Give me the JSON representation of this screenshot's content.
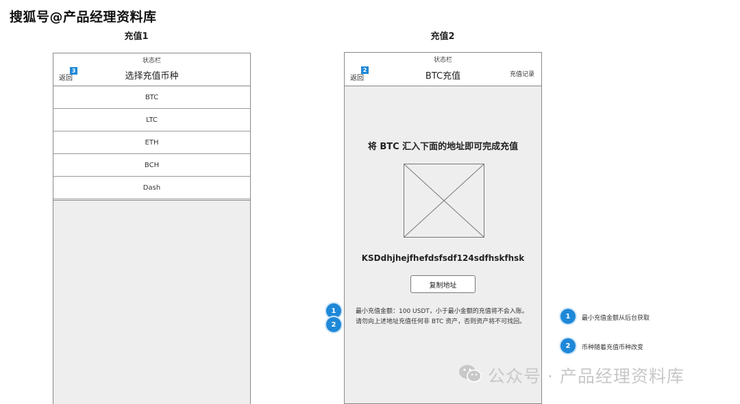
{
  "watermark_top": "搜狐号@产品经理资料库",
  "screen1": {
    "title": "充值1",
    "status_bar": "状态栏",
    "back_label": "返回",
    "badge": "3",
    "nav_title": "选择充值币种",
    "coins": [
      "BTC",
      "LTC",
      "ETH",
      "BCH",
      "Dash"
    ]
  },
  "screen2": {
    "title": "充值2",
    "status_bar": "状态栏",
    "back_label": "返回",
    "badge": "2",
    "nav_title": "BTC充值",
    "nav_right": "充值记录",
    "headline": "将 BTC 汇入下面的地址即可完成充值",
    "address": "KSDdhjhejfhefdsfsdf124sdfhskfhsk",
    "copy_button": "复制地址",
    "notice_line1": "最小充值金额：100 USDT，小于最小金额的充值将不会入账。",
    "notice_line2": "请勿向上述地址充值任何非 BTC 资产，否则资产将不可找回。",
    "left_badges": [
      "1",
      "2"
    ]
  },
  "annotations": [
    {
      "number": "1",
      "text": "最小充值金额从后台获取"
    },
    {
      "number": "2",
      "text": "币种随着充值币种改变"
    }
  ],
  "watermark_bottom": "公众号 · 产品经理资料库",
  "colors": {
    "accent": "#1e88d8",
    "frame": "#888888",
    "placeholder_bg": "#eeeeee"
  }
}
